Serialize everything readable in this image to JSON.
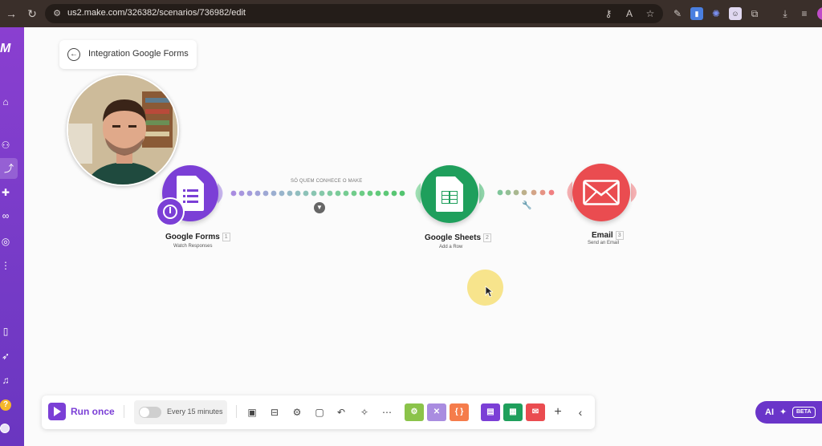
{
  "browser": {
    "url": "us2.make.com/326382/scenarios/736982/edit",
    "back_icon": "arrow-left-icon",
    "reload_icon": "reload-icon"
  },
  "sidebar": {
    "brand": "M",
    "help": "?",
    "icons": [
      "home-icon",
      "team-icon",
      "share-icon",
      "puzzle-icon",
      "link-icon",
      "globe-icon",
      "more-icon",
      "book-icon",
      "rocket-icon",
      "bell-icon"
    ]
  },
  "scenario": {
    "title": "Integration Google Forms"
  },
  "modules": {
    "forms": {
      "name": "Google Forms",
      "num": "1",
      "action": "Watch Responses",
      "color": "#7b3fd6"
    },
    "sheets": {
      "name": "Google Sheets",
      "num": "2",
      "action": "Add a Row",
      "color": "#1f9f5c"
    },
    "email": {
      "name": "Email",
      "num": "3",
      "action": "Send an Email",
      "color": "#ea4c50"
    }
  },
  "route": {
    "label": "SÓ QUEM CONHECE O MAKE"
  },
  "toolbar": {
    "run_label": "Run once",
    "schedule_label": "Every 15 minutes",
    "sq_labels": [
      "⚙",
      "✕",
      "{ }"
    ]
  },
  "ai": {
    "label": "AI",
    "badge": "BETA"
  },
  "colors": {
    "accent": "#7b3fd6",
    "sheets": "#1f9f5c",
    "email": "#ea4c50",
    "tools_green": "#8bc34a",
    "tools_purple": "#a98ce0",
    "tools_orange": "#f57c4b"
  }
}
